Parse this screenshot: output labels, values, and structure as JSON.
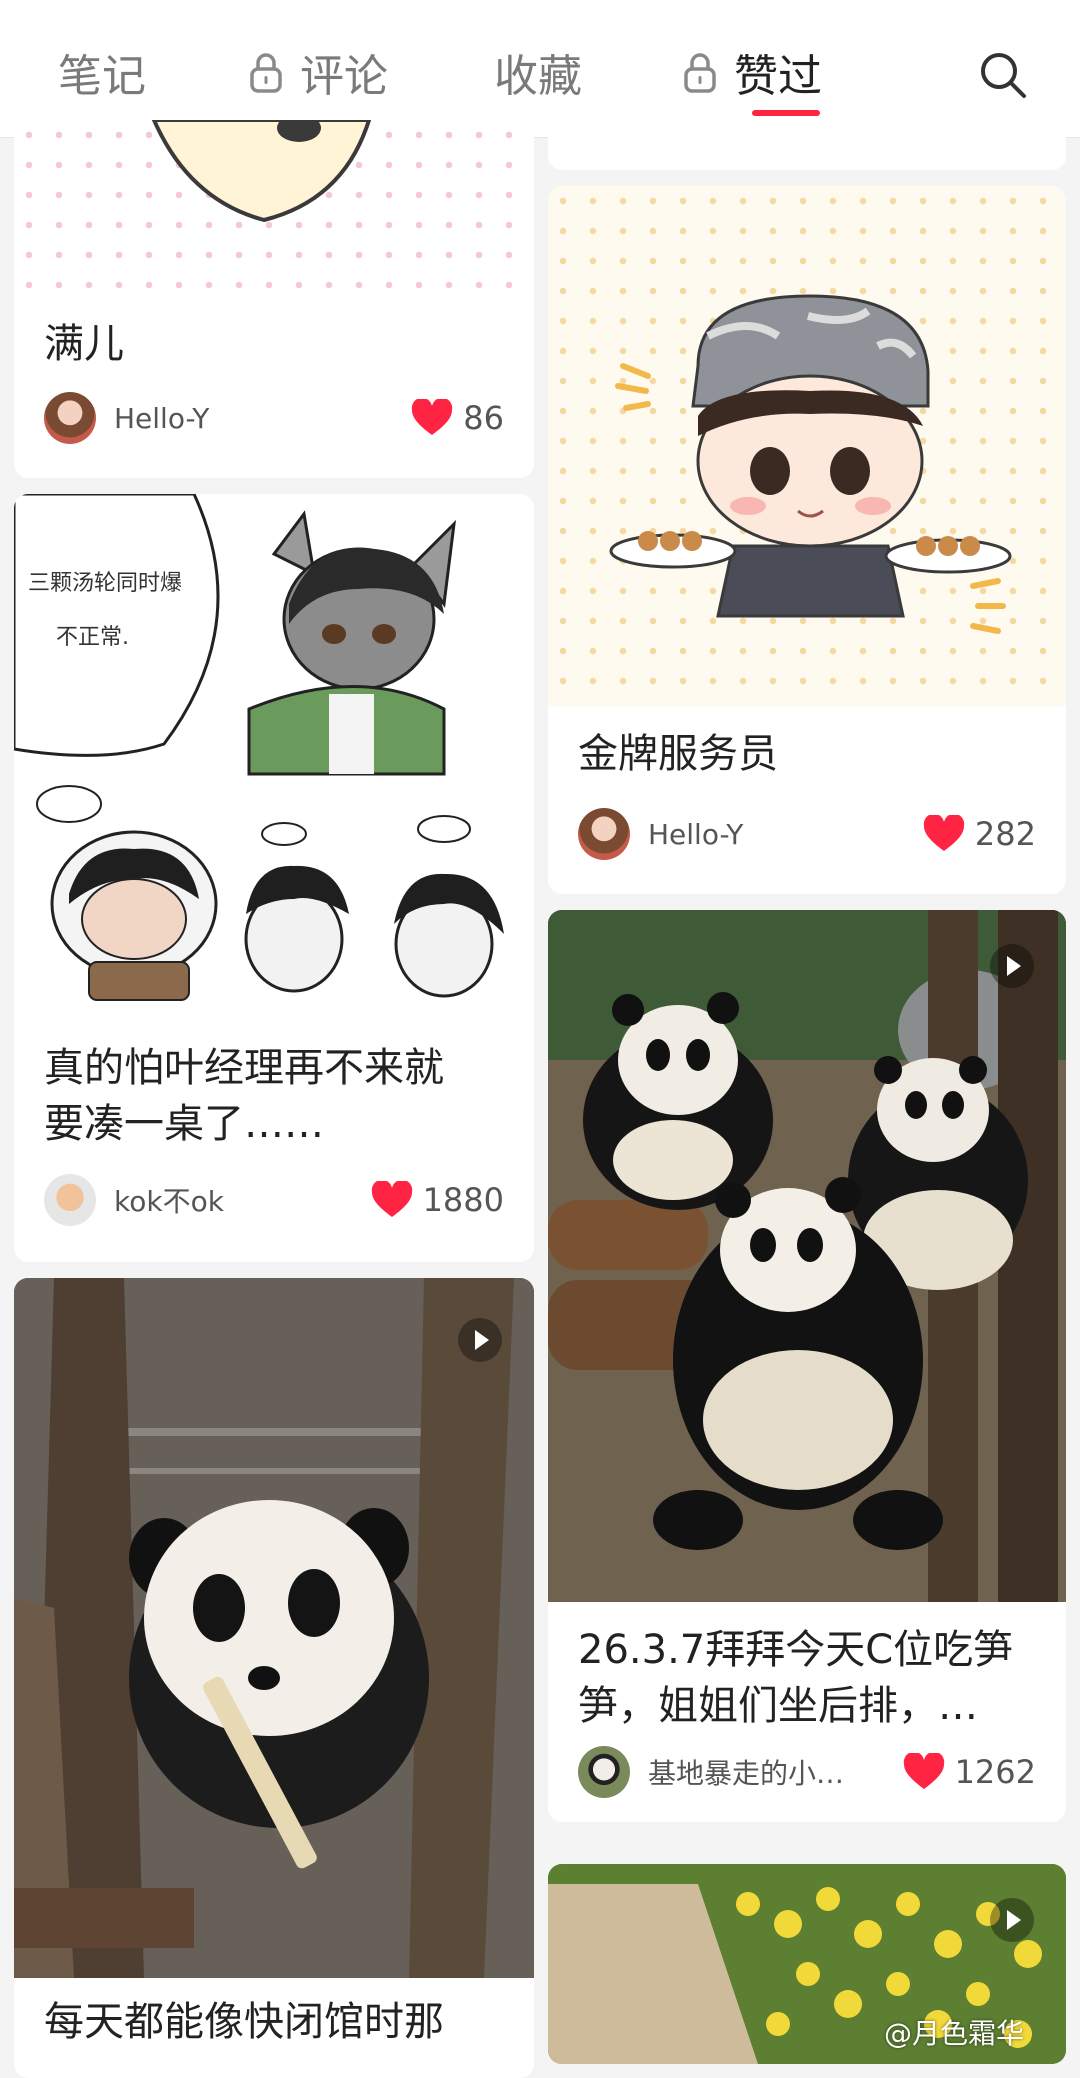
{
  "tabs": [
    {
      "label": "笔记",
      "locked": false,
      "active": false
    },
    {
      "label": "评论",
      "locked": true,
      "active": false
    },
    {
      "label": "收藏",
      "locked": false,
      "active": false
    },
    {
      "label": "赞过",
      "locked": true,
      "active": true
    }
  ],
  "search_icon": "search-icon",
  "like_color": "#ff2442",
  "cards": {
    "manr": {
      "title": "满儿",
      "author": "Hello-Y",
      "likes": "86"
    },
    "pa_ye": {
      "title_line1": "真的怕叶经理再不来就",
      "title_line2": "要凑一桌了……",
      "author": "kok不ok",
      "likes": "1880"
    },
    "jinpai": {
      "title": "金牌服务员",
      "author": "Hello-Y",
      "likes": "282"
    },
    "panda_group": {
      "title_line1": "26.3.7拜拜今天C位吃笋",
      "title_line2": "笋，姐姐们坐后排，…",
      "author": "基地暴走的小…",
      "likes": "1262"
    },
    "panda_single": {
      "title": "每天都能像快闭馆时那"
    }
  },
  "comic_text": {
    "line1": "三颗汤轮同时爆",
    "line2": "不正常."
  },
  "watermark": "@月色霜华"
}
